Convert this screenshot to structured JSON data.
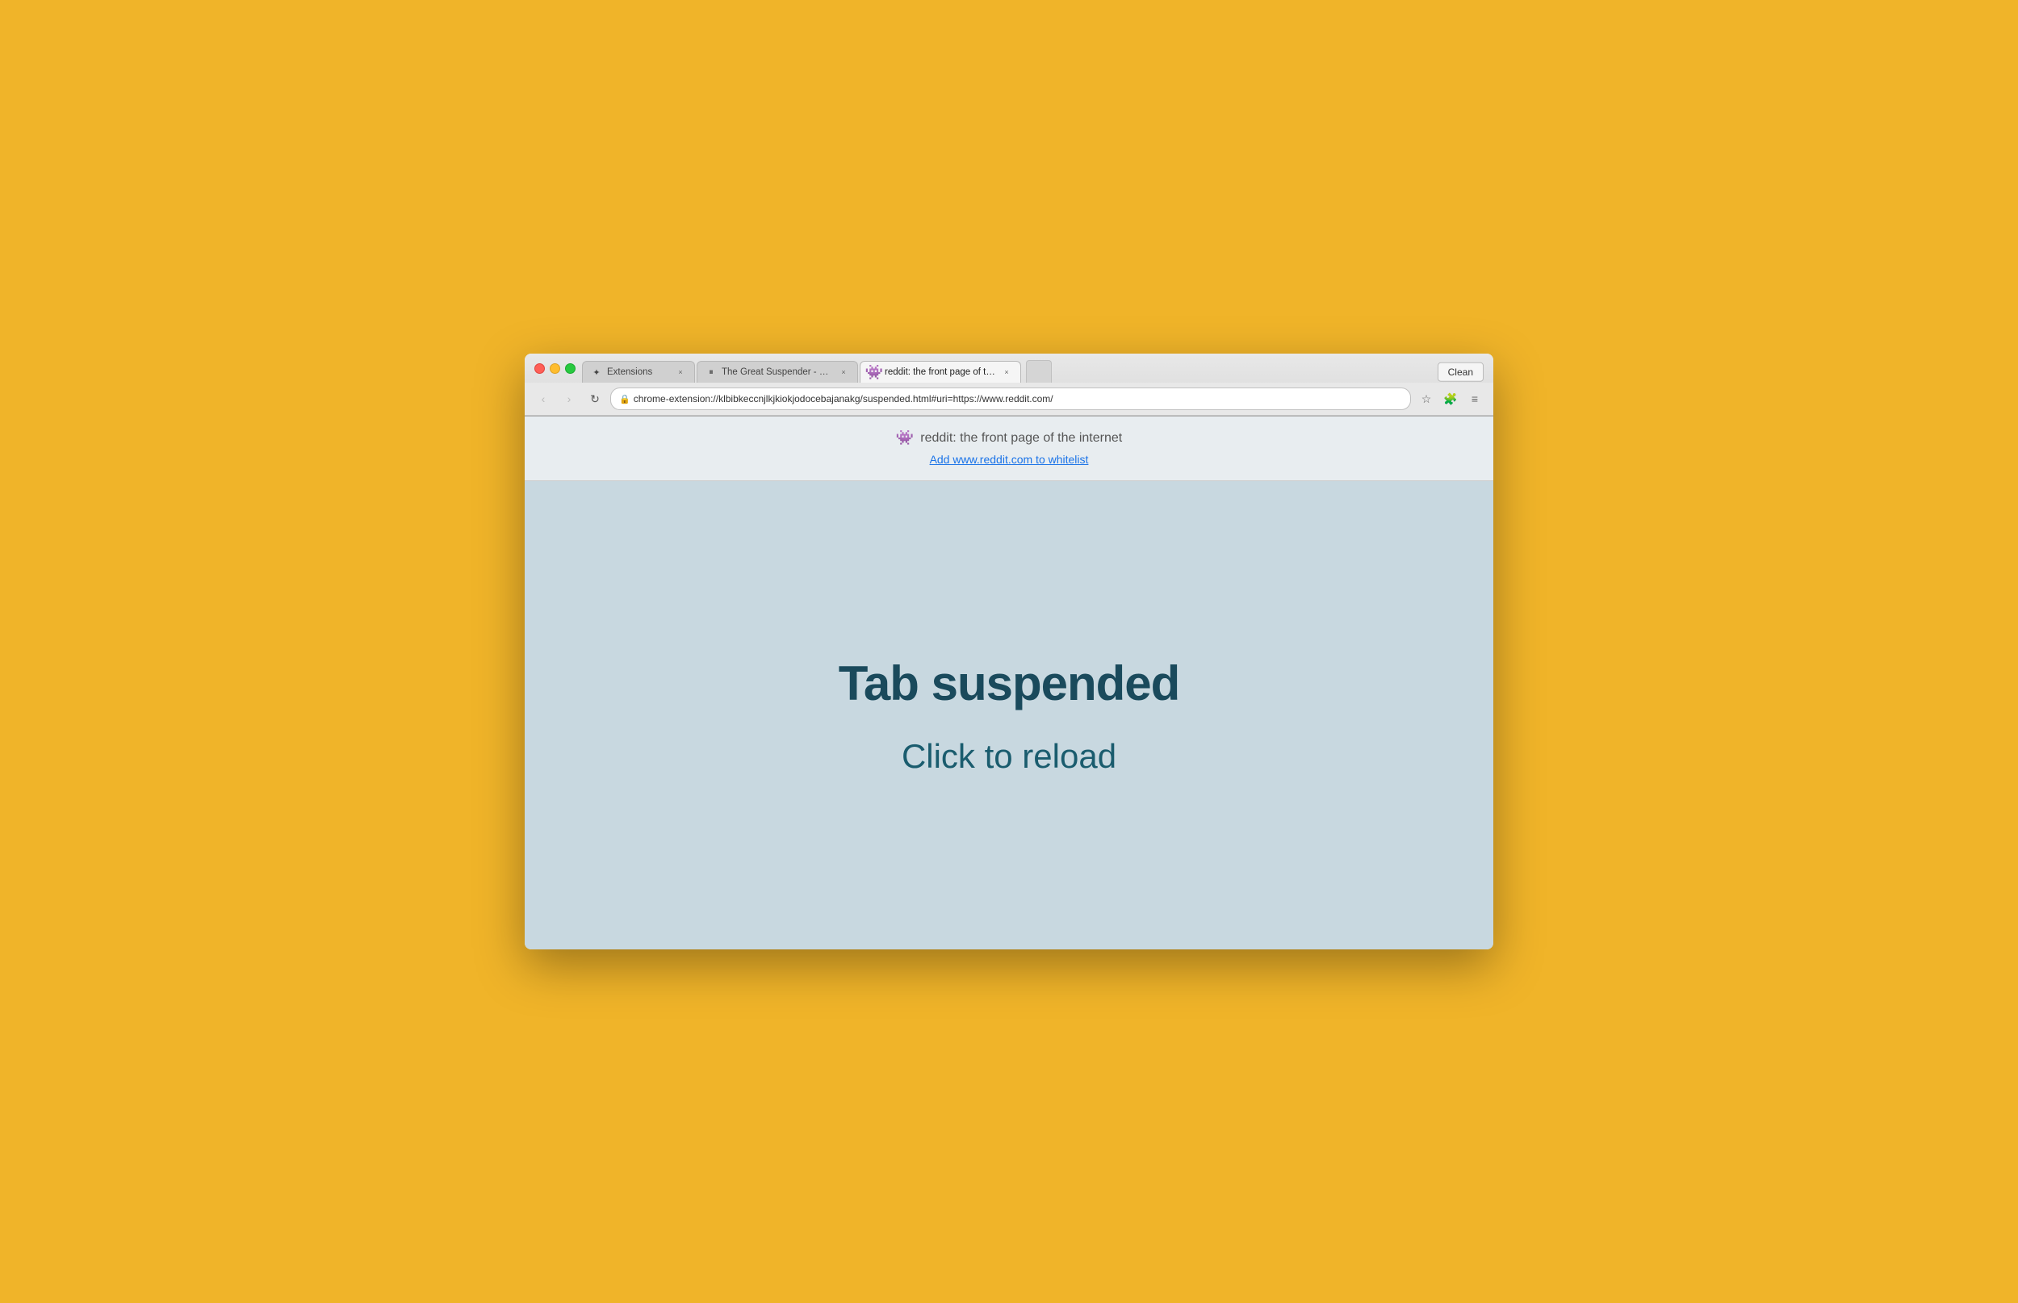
{
  "browser": {
    "background_color": "#f0b429",
    "clean_button_label": "Clean"
  },
  "tabs": [
    {
      "id": "tab-extensions",
      "title": "Extensions",
      "favicon": "✦",
      "active": false,
      "close_label": "×"
    },
    {
      "id": "tab-suspender",
      "title": "The Great Suspender - Ch…",
      "favicon": "⏸",
      "active": false,
      "close_label": "×"
    },
    {
      "id": "tab-reddit",
      "title": "reddit: the front page of th…",
      "favicon": "👾",
      "active": true,
      "close_label": "×"
    }
  ],
  "toolbar": {
    "back_label": "‹",
    "forward_label": "›",
    "reload_label": "↻",
    "address": "chrome-extension://klbibkeccnjlkjkiokjodocebajanakg/suspended.html#uri=https://www.reddit.com/",
    "star_label": "☆",
    "menu_label": "≡"
  },
  "info_bar": {
    "site_title": "reddit: the front page of the internet",
    "whitelist_link_text": "Add www.reddit.com to whitelist"
  },
  "main": {
    "suspended_title": "Tab suspended",
    "reload_text": "Click to reload"
  }
}
